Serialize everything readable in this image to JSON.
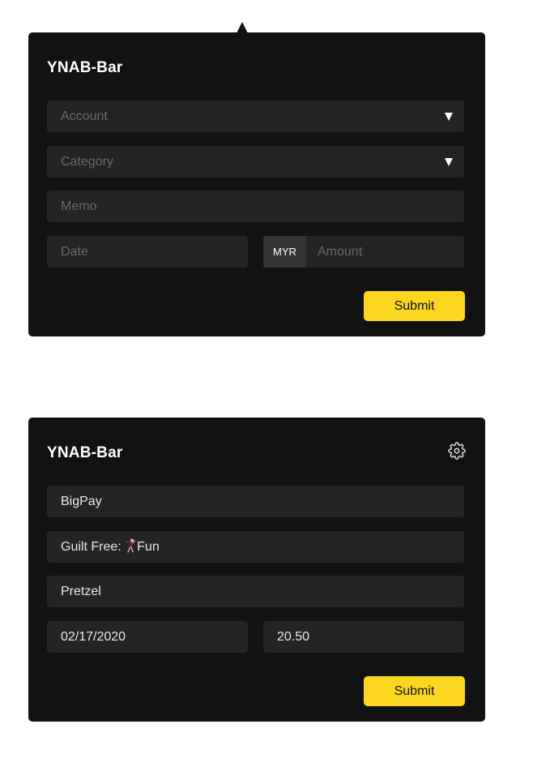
{
  "top_form": {
    "title": "YNAB-Bar",
    "account_placeholder": "Account",
    "category_placeholder": "Category",
    "memo_placeholder": "Memo",
    "date_placeholder": "Date",
    "currency": "MYR",
    "amount_placeholder": "Amount",
    "submit_label": "Submit"
  },
  "bottom_form": {
    "title": "YNAB-Bar",
    "account": "BigPay",
    "category_prefix": "Guilt Free: ",
    "category_icon": "dancer-emoji",
    "category_name": "Fun",
    "memo": "Pretzel",
    "date": "02/17/2020",
    "amount": "20.50",
    "submit_label": "Submit"
  },
  "colors": {
    "panel_bg": "#121212",
    "field_bg": "#242424",
    "accent": "#fcd61f",
    "placeholder": "#6a6a6a",
    "text": "#e9e9e9"
  }
}
